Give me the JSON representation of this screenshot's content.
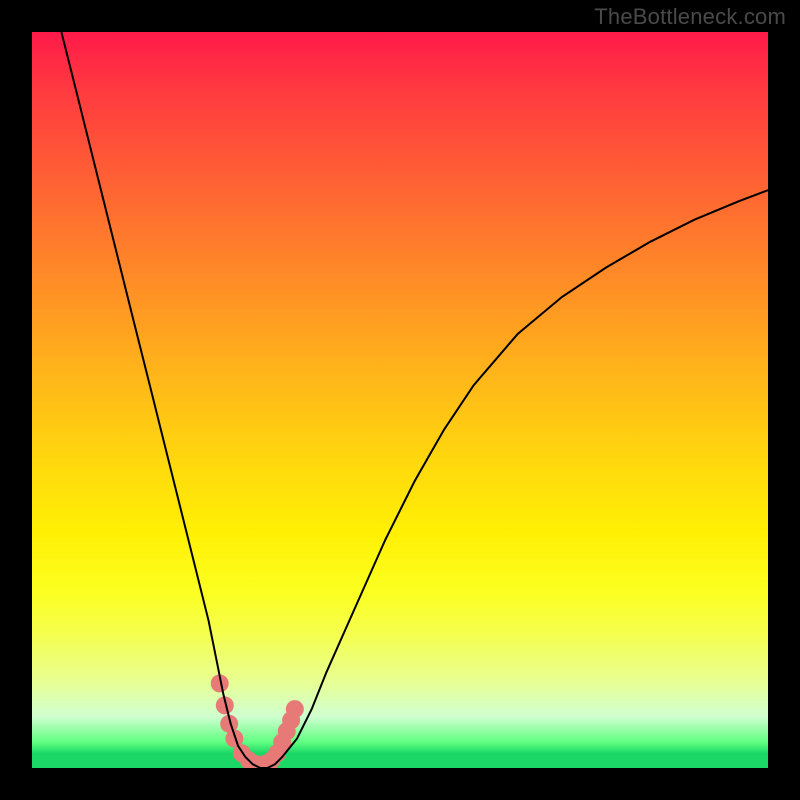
{
  "watermark": {
    "text": "TheBottleneck.com"
  },
  "chart_data": {
    "type": "line",
    "title": "",
    "xlabel": "",
    "ylabel": "",
    "xlim": [
      0,
      100
    ],
    "ylim": [
      0,
      100
    ],
    "grid": false,
    "legend": false,
    "series": [
      {
        "name": "bottleneck-curve",
        "x": [
          4,
          6,
          8,
          10,
          12,
          14,
          16,
          18,
          20,
          22,
          24,
          25,
          26,
          27,
          28,
          29,
          30,
          31,
          32,
          33,
          34,
          36,
          38,
          40,
          44,
          48,
          52,
          56,
          60,
          66,
          72,
          78,
          84,
          90,
          96,
          100
        ],
        "values": [
          100,
          92,
          84,
          76,
          68,
          60,
          52,
          44,
          36,
          28,
          20,
          15,
          10,
          6,
          3,
          1.5,
          0.5,
          0,
          0,
          0.5,
          1.5,
          4,
          8,
          13,
          22,
          31,
          39,
          46,
          52,
          59,
          64,
          68,
          71.5,
          74.5,
          77,
          78.5
        ]
      },
      {
        "name": "highlight-dots",
        "x": [
          25.5,
          26.2,
          26.8,
          27.5,
          28.5,
          29.5,
          30.5,
          31.5,
          32.5,
          33.3,
          34.0,
          34.6,
          35.2,
          35.7
        ],
        "values": [
          11.5,
          8.5,
          6.0,
          4.0,
          2.0,
          1.0,
          0.5,
          0.5,
          1.0,
          2.0,
          3.5,
          5.0,
          6.5,
          8.0
        ]
      }
    ],
    "background_gradient": {
      "stops": [
        {
          "pct": 0,
          "color": "#ff1a4a"
        },
        {
          "pct": 18,
          "color": "#ff5a36"
        },
        {
          "pct": 38,
          "color": "#ff9a22"
        },
        {
          "pct": 58,
          "color": "#ffd70e"
        },
        {
          "pct": 76,
          "color": "#fcff20"
        },
        {
          "pct": 93,
          "color": "#d0ffd0"
        },
        {
          "pct": 98,
          "color": "#1bd765"
        },
        {
          "pct": 100,
          "color": "#1bd765"
        }
      ]
    },
    "curve_style": {
      "color": "#000000",
      "width": 2
    },
    "dot_style": {
      "color": "#e77a77",
      "radius": 9
    }
  }
}
